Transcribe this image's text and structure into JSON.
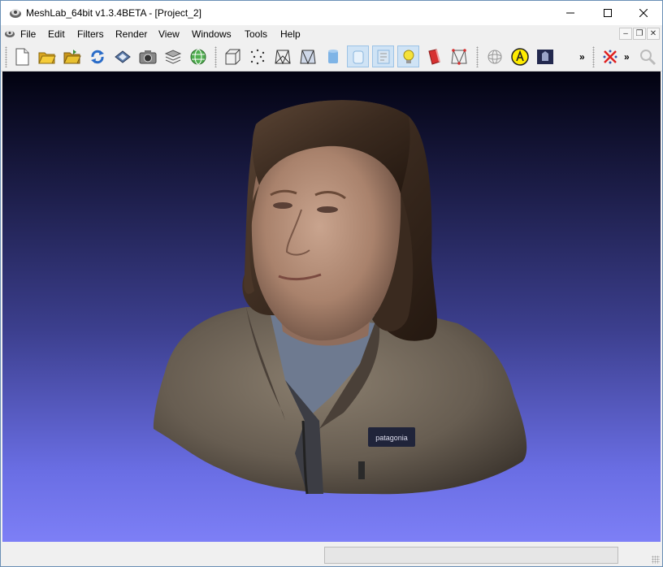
{
  "window": {
    "title": "MeshLab_64bit v1.3.4BETA - [Project_2]",
    "app_icon": "meshlab-logo-icon"
  },
  "title_controls": [
    "minimize-icon",
    "maximize-icon",
    "close-icon"
  ],
  "menu": {
    "items": [
      "File",
      "Edit",
      "Filters",
      "Render",
      "View",
      "Windows",
      "Tools",
      "Help"
    ],
    "mdi_controls": [
      "mdi-minimize-icon",
      "mdi-restore-icon",
      "mdi-close-icon"
    ]
  },
  "toolbar": {
    "groups": [
      [
        "new-project-icon",
        "open-project-icon",
        "import-mesh-icon",
        "reload-icon",
        "save-icon",
        "snapshot-icon",
        "layers-icon",
        "globe-icon"
      ],
      [
        "bounding-box-icon",
        "points-icon",
        "wireframe-icon",
        "hidden-lines-icon",
        "flat-shading-icon",
        "smooth-shading-icon",
        "texture-icon",
        "light-icon",
        "color-icon",
        "selection-icon"
      ],
      [
        "trackball-icon",
        "annotation-icon",
        "info-icon"
      ],
      [
        "delete-mesh-icon",
        "zoom-icon"
      ]
    ],
    "more_label": "»",
    "active_tools": [
      "flat-shading-icon",
      "smooth-shading-icon",
      "texture-icon"
    ]
  },
  "viewport": {
    "content": "3d-mesh-head-bust",
    "background_top": "#020210",
    "background_bottom": "#7d7ff6",
    "logo_text": "patagonia"
  },
  "statusbar": {
    "progress": 0
  }
}
